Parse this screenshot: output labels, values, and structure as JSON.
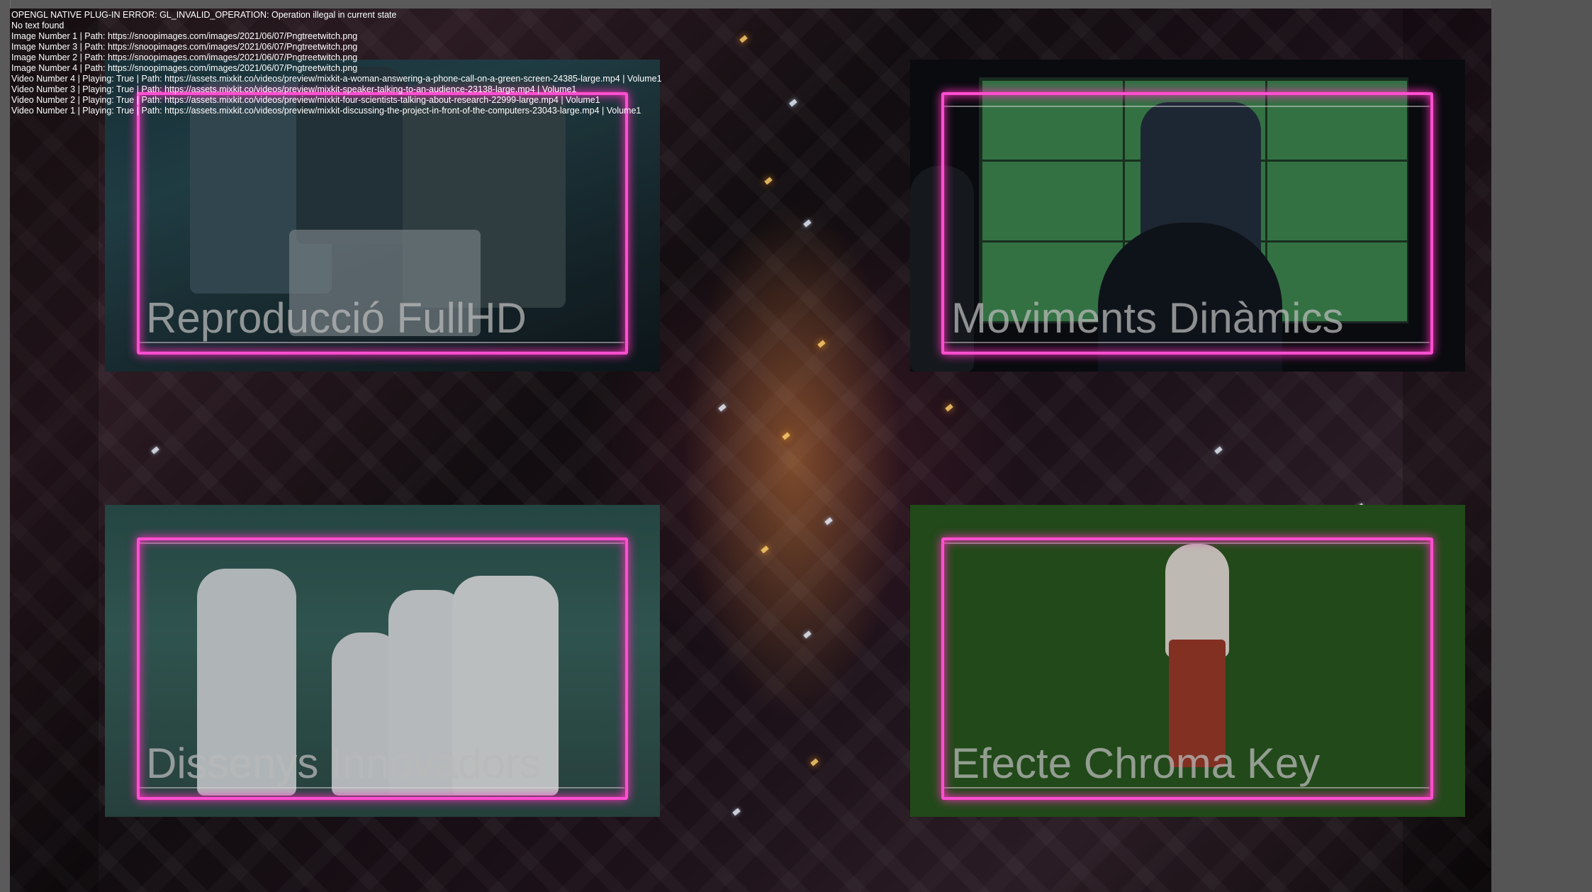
{
  "log_lines": [
    "OPENGL NATIVE PLUG-IN ERROR: GL_INVALID_OPERATION: Operation illegal in current state",
    "No text found",
    "Image Number 1 | Path: https://snoopimages.com/images/2021/06/07/Pngtreetwitch.png",
    "Image Number 3 | Path: https://snoopimages.com/images/2021/06/07/Pngtreetwitch.png",
    "Image Number 2 | Path: https://snoopimages.com/images/2021/06/07/Pngtreetwitch.png",
    "Image Number 4 | Path: https://snoopimages.com/images/2021/06/07/Pngtreetwitch.png",
    "Video Number 4 | Playing: True | Path: https://assets.mixkit.co/videos/preview/mixkit-a-woman-answering-a-phone-call-on-a-green-screen-24385-large.mp4 | Volume1",
    "Video Number 3 | Playing: True | Path: https://assets.mixkit.co/videos/preview/mixkit-speaker-talking-to-an-audience-23138-large.mp4 | Volume1",
    "Video Number 2 | Playing: True | Path: https://assets.mixkit.co/videos/preview/mixkit-four-scientists-talking-about-research-22999-large.mp4 | Volume1",
    "Video Number 1 | Playing: True | Path: https://assets.mixkit.co/videos/preview/mixkit-discussing-the-project-in-front-of-the-computers-23043-large.mp4 | Volume1"
  ],
  "panels": {
    "top_left": {
      "caption": "Reproducció FullHD"
    },
    "top_right": {
      "caption": "Moviments Dinàmics"
    },
    "bottom_left": {
      "caption": "Dissenys Innovadors"
    },
    "bottom_right": {
      "caption": "Efecte Chroma Key"
    }
  },
  "colors": {
    "neon_frame": "#ff4fd0",
    "chroma_green": "#2a5a1f",
    "caption_text": "#b9b9b9"
  }
}
